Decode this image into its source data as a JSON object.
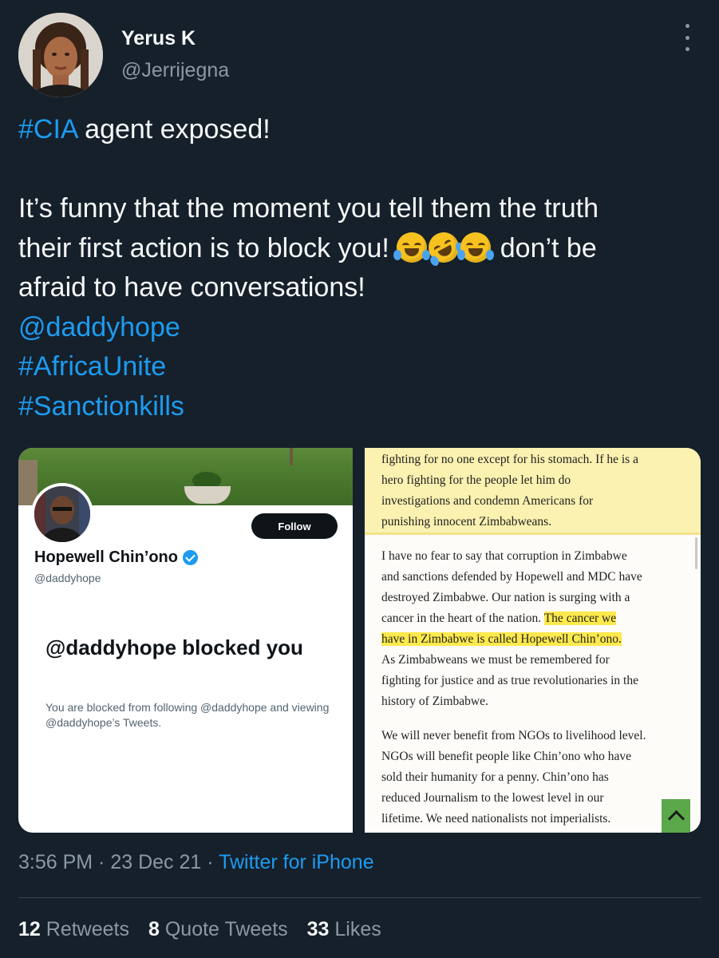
{
  "author": {
    "display_name": "Yerus K",
    "handle": "@Jerrijegna"
  },
  "tweet": {
    "hashtag_cia": "#CIA",
    "line1_rest": " agent exposed!",
    "line2": "It’s funny that the moment you tell them the truth",
    "line3_start": "their first action is to block you! ",
    "line3_end": " don’t be",
    "line4": "afraid to have conversations!",
    "mention": "@daddyhope",
    "hashtag_africa": "#AfricaUnite",
    "hashtag_sanction": "#Sanctionkills",
    "emojis": [
      "face-with-tears-of-joy",
      "rolling-on-the-floor-laughing",
      "face-with-tears-of-joy"
    ]
  },
  "media_left": {
    "follow_label": "Follow",
    "name": "Hopewell Chin’ono",
    "handle": "@daddyhope",
    "blocked_title": "@daddyhope blocked you",
    "blocked_desc": "You are blocked from following @daddyhope and viewing @daddyhope’s Tweets."
  },
  "media_right": {
    "top_lines": [
      "fighting for no one except for his stomach. If he is a",
      "hero fighting for the people let him do",
      "investigations and condemn Americans for",
      "punishing innocent Zimbabweans."
    ],
    "para1_lines": [
      "I have no fear to say that corruption in Zimbabwe",
      "and sanctions defended by Hopewell and MDC have",
      "destroyed Zimbabwe.  Our nation is surging with a"
    ],
    "para1_l4_plain": "cancer in the heart of the nation. ",
    "para1_l4_hl": "The cancer we",
    "para1_l5_hl": "have in Zimbabwe is called Hopewell Chin’ono.",
    "para1_rest": [
      "As Zimbabweans we must be remembered for",
      "fighting for justice and as true revolutionaries in the",
      "history of Zimbabwe."
    ],
    "para2_lines": [
      "We will never benefit from NGOs to livelihood level.",
      "NGOs will benefit people like Chin’ono who have",
      "sold their humanity for a penny. Chin’ono has",
      "reduced Journalism to the lowest level in our",
      "lifetime. We need nationalists not imperialists."
    ]
  },
  "meta": {
    "time_date": "3:56 PM · 23 Dec 21 · ",
    "source": "Twitter for iPhone"
  },
  "stats": {
    "retweets_count": "12",
    "retweets_label": "Retweets",
    "quotes_count": "8",
    "quotes_label": "Quote Tweets",
    "likes_count": "33",
    "likes_label": "Likes"
  },
  "colors": {
    "background": "#15202b",
    "link": "#1d9bf0",
    "secondary_text": "#8b98a5",
    "highlight": "#fde94c"
  }
}
